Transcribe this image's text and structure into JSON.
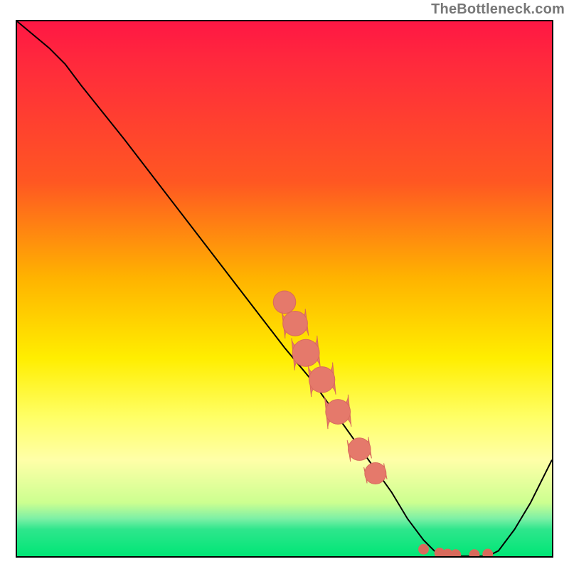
{
  "attribution_text": "TheBottleneck.com",
  "colors": {
    "curve": "#000000",
    "marker_fill": "#e5796b",
    "marker_stroke": "#d86a5c"
  },
  "chart_data": {
    "type": "line",
    "title": "",
    "xlabel": "",
    "ylabel": "",
    "xlim": [
      0,
      100
    ],
    "ylim": [
      0,
      100
    ],
    "curve": [
      {
        "x": 0,
        "y": 100
      },
      {
        "x": 6,
        "y": 95
      },
      {
        "x": 9,
        "y": 92
      },
      {
        "x": 12,
        "y": 88
      },
      {
        "x": 20,
        "y": 78
      },
      {
        "x": 30,
        "y": 65
      },
      {
        "x": 40,
        "y": 52
      },
      {
        "x": 50,
        "y": 39
      },
      {
        "x": 55,
        "y": 33
      },
      {
        "x": 60,
        "y": 26
      },
      {
        "x": 65,
        "y": 19
      },
      {
        "x": 70,
        "y": 12
      },
      {
        "x": 73,
        "y": 7
      },
      {
        "x": 76,
        "y": 3
      },
      {
        "x": 78,
        "y": 1
      },
      {
        "x": 80,
        "y": 0
      },
      {
        "x": 84,
        "y": 0
      },
      {
        "x": 88,
        "y": 0
      },
      {
        "x": 90,
        "y": 1
      },
      {
        "x": 93,
        "y": 5
      },
      {
        "x": 96,
        "y": 10
      },
      {
        "x": 100,
        "y": 18
      }
    ],
    "marker_clusters": [
      {
        "x": 50,
        "y_top": 48,
        "y_bot": 47,
        "w": 2.0
      },
      {
        "x": 52,
        "y_top": 46,
        "y_bot": 41,
        "w": 2.2
      },
      {
        "x": 54,
        "y_top": 41,
        "y_bot": 35,
        "w": 2.4
      },
      {
        "x": 57,
        "y_top": 36,
        "y_bot": 30,
        "w": 2.3
      },
      {
        "x": 60,
        "y_top": 30,
        "y_bot": 24,
        "w": 2.2
      },
      {
        "x": 64,
        "y_top": 22,
        "y_bot": 18,
        "w": 2.0
      },
      {
        "x": 67,
        "y_top": 17,
        "y_bot": 14,
        "w": 1.9
      }
    ],
    "bottom_dots": [
      {
        "x": 76,
        "y": 1.3
      },
      {
        "x": 79,
        "y": 0.6
      },
      {
        "x": 80.5,
        "y": 0.4
      },
      {
        "x": 82,
        "y": 0.3
      },
      {
        "x": 85.5,
        "y": 0.3
      },
      {
        "x": 88,
        "y": 0.4
      }
    ]
  }
}
